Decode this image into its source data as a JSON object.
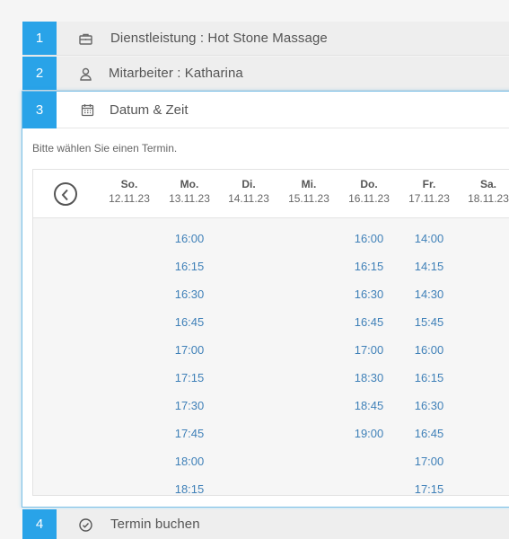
{
  "steps": {
    "service": {
      "number": "1",
      "label": "Dienstleistung : Hot Stone Massage",
      "icon": "briefcase-icon"
    },
    "employee": {
      "number": "2",
      "label": "Mitarbeiter : Katharina",
      "icon": "user-icon"
    },
    "datetime": {
      "number": "3",
      "label": "Datum & Zeit",
      "icon": "calendar-icon"
    },
    "book": {
      "number": "4",
      "label": "Termin buchen",
      "icon": "check-circle-icon"
    }
  },
  "instruction": "Bitte wählen Sie einen Termin.",
  "calendar": {
    "prev_icon": "chevron-left-circle-icon",
    "days": [
      {
        "name": "So.",
        "date": "12.11.23",
        "times": []
      },
      {
        "name": "Mo.",
        "date": "13.11.23",
        "times": [
          "16:00",
          "16:15",
          "16:30",
          "16:45",
          "17:00",
          "17:15",
          "17:30",
          "17:45",
          "18:00",
          "18:15"
        ]
      },
      {
        "name": "Di.",
        "date": "14.11.23",
        "times": []
      },
      {
        "name": "Mi.",
        "date": "15.11.23",
        "times": []
      },
      {
        "name": "Do.",
        "date": "16.11.23",
        "times": [
          "16:00",
          "16:15",
          "16:30",
          "16:45",
          "17:00",
          "18:30",
          "18:45",
          "19:00"
        ]
      },
      {
        "name": "Fr.",
        "date": "17.11.23",
        "times": [
          "14:00",
          "14:15",
          "14:30",
          "15:45",
          "16:00",
          "16:15",
          "16:30",
          "16:45",
          "17:00",
          "17:15"
        ]
      },
      {
        "name": "Sa.",
        "date": "18.11.23",
        "times": []
      }
    ]
  },
  "colors": {
    "accent": "#29a3e8",
    "time_link": "#3f80b8"
  }
}
